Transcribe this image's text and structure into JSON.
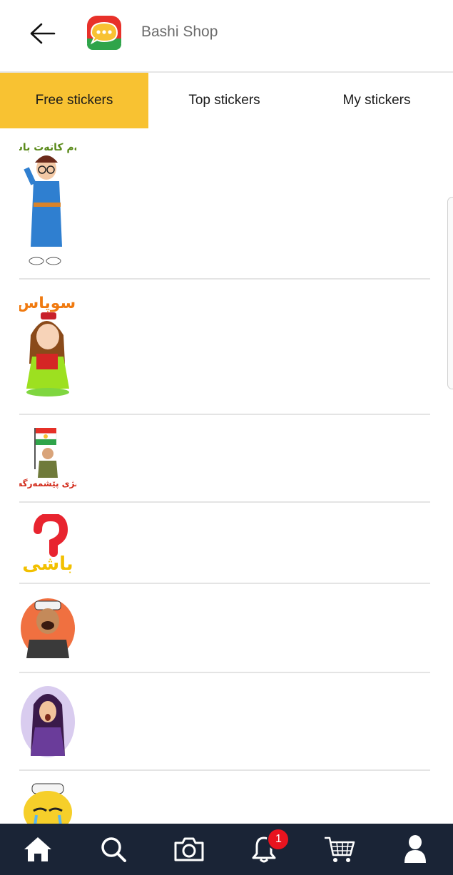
{
  "header": {
    "title": "Bashi Shop",
    "back_icon": "arrow-left-icon",
    "logo_icon": "chat-bubble-logo-icon"
  },
  "tabs": [
    {
      "label": "Free stickers",
      "active": true
    },
    {
      "label": "Top stickers",
      "active": false
    },
    {
      "label": "My stickers",
      "active": false
    }
  ],
  "stickers": [
    {
      "name": "boy-with-glasses-sticker",
      "caption": "ئەم کاتەت باش"
    },
    {
      "name": "girl-thinking-sticker",
      "caption": "سوپاس"
    },
    {
      "name": "soldier-with-flag-sticker",
      "caption": "بژی پێشمەرگە"
    },
    {
      "name": "question-mark-bashi-sticker",
      "caption": "باشی"
    },
    {
      "name": "old-man-laughing-sticker",
      "caption": ""
    },
    {
      "name": "woman-surprised-sticker",
      "caption": ""
    },
    {
      "name": "man-crying-sticker",
      "caption": ""
    }
  ],
  "bottom_nav": {
    "items": [
      "home-icon",
      "search-icon",
      "camera-icon",
      "bell-icon",
      "cart-icon",
      "profile-icon"
    ],
    "notification_count": "1"
  },
  "colors": {
    "accent": "#f8c232",
    "nav_bg": "#1a2436",
    "badge": "#e8141f"
  }
}
